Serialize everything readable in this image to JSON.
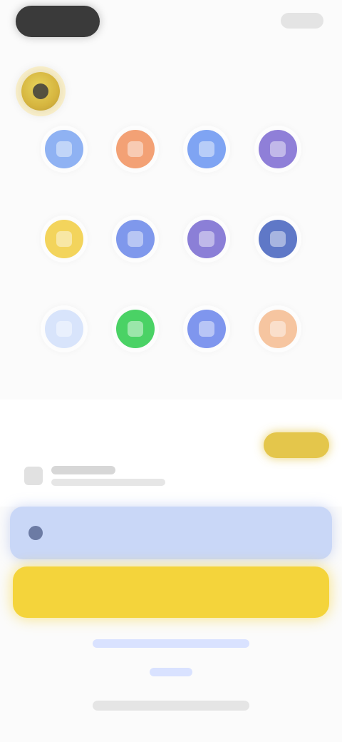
{
  "topbar": {
    "left": "",
    "right": ""
  },
  "header": {
    "title": "",
    "badge_color": "#d6b53f"
  },
  "grid": {
    "items": [
      {
        "label": "",
        "color": "#8fb2f3"
      },
      {
        "label": "",
        "color": "#f3a175"
      },
      {
        "label": "",
        "color": "#7fa4f3"
      },
      {
        "label": "",
        "color": "#8f7fd8"
      },
      {
        "label": "",
        "color": "#f3d45c"
      },
      {
        "label": "",
        "color": "#7f98ec"
      },
      {
        "label": "",
        "color": "#8b7fd7"
      },
      {
        "label": "",
        "color": "#5f78c7"
      },
      {
        "label": "",
        "color": "#d8e4fb"
      },
      {
        "label": "",
        "color": "#4ad265"
      },
      {
        "label": "",
        "color": "#7f96ee"
      },
      {
        "label": "",
        "color": "#f6c5a0"
      }
    ]
  },
  "section": {
    "promo_chip": "",
    "row": {
      "title": "",
      "subtitle": "",
      "value": ""
    }
  },
  "band": {
    "label": "",
    "value": ""
  },
  "cta": {
    "label": ""
  },
  "footer": {
    "line1": "",
    "line2": "",
    "line3": ""
  }
}
